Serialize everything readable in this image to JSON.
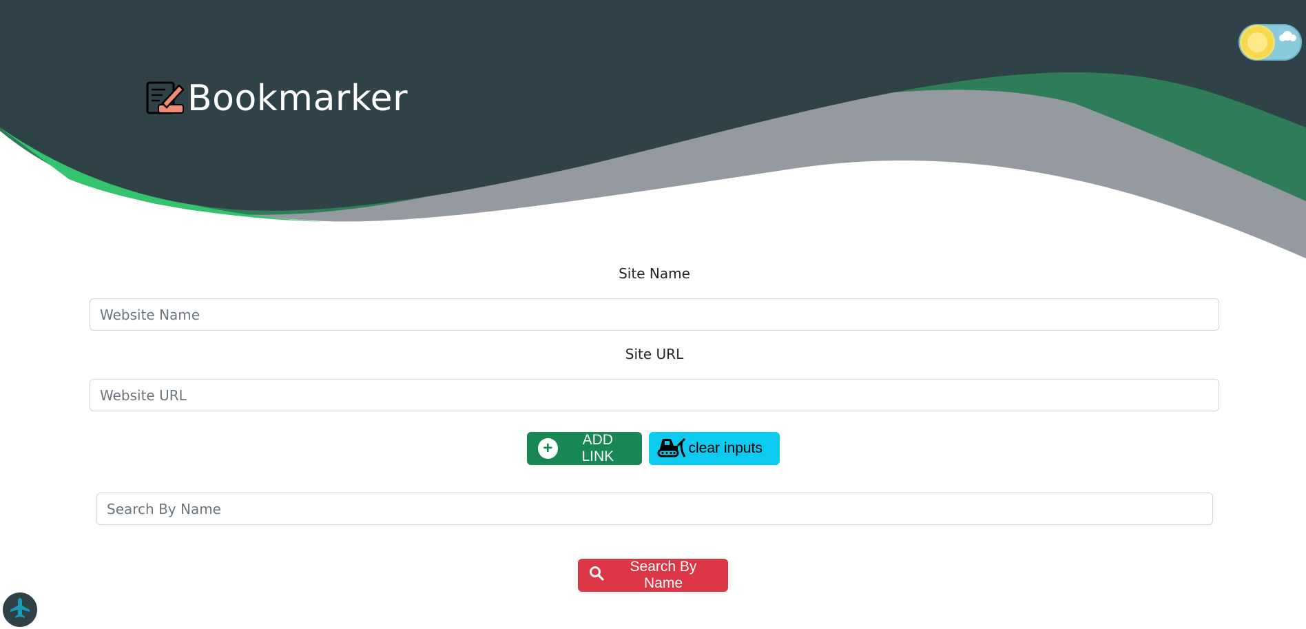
{
  "header": {
    "app_title": "Bookmarker",
    "logo_icon": "bookmark-edit-icon",
    "theme_toggle_icon": "sun-icon"
  },
  "form": {
    "site_name_label": "Site Name",
    "site_name_placeholder": "Website Name",
    "site_url_label": "Site URL",
    "site_url_placeholder": "Website URL",
    "add_button_label": "ADD LINK",
    "add_button_icon": "plus-circle-icon",
    "clear_button_label": "clear inputs",
    "clear_button_icon": "bulldozer-icon"
  },
  "search": {
    "placeholder": "Search By Name",
    "button_label": "Search By Name",
    "button_icon": "search-icon"
  },
  "floating": {
    "icon": "plane-icon"
  },
  "colors": {
    "header_dark": "#2e4248",
    "wave_green": "#2f7d58",
    "wave_gray": "#9599a0",
    "add_button": "#198754",
    "clear_button": "#0dcaf0",
    "search_button": "#dc3545"
  }
}
